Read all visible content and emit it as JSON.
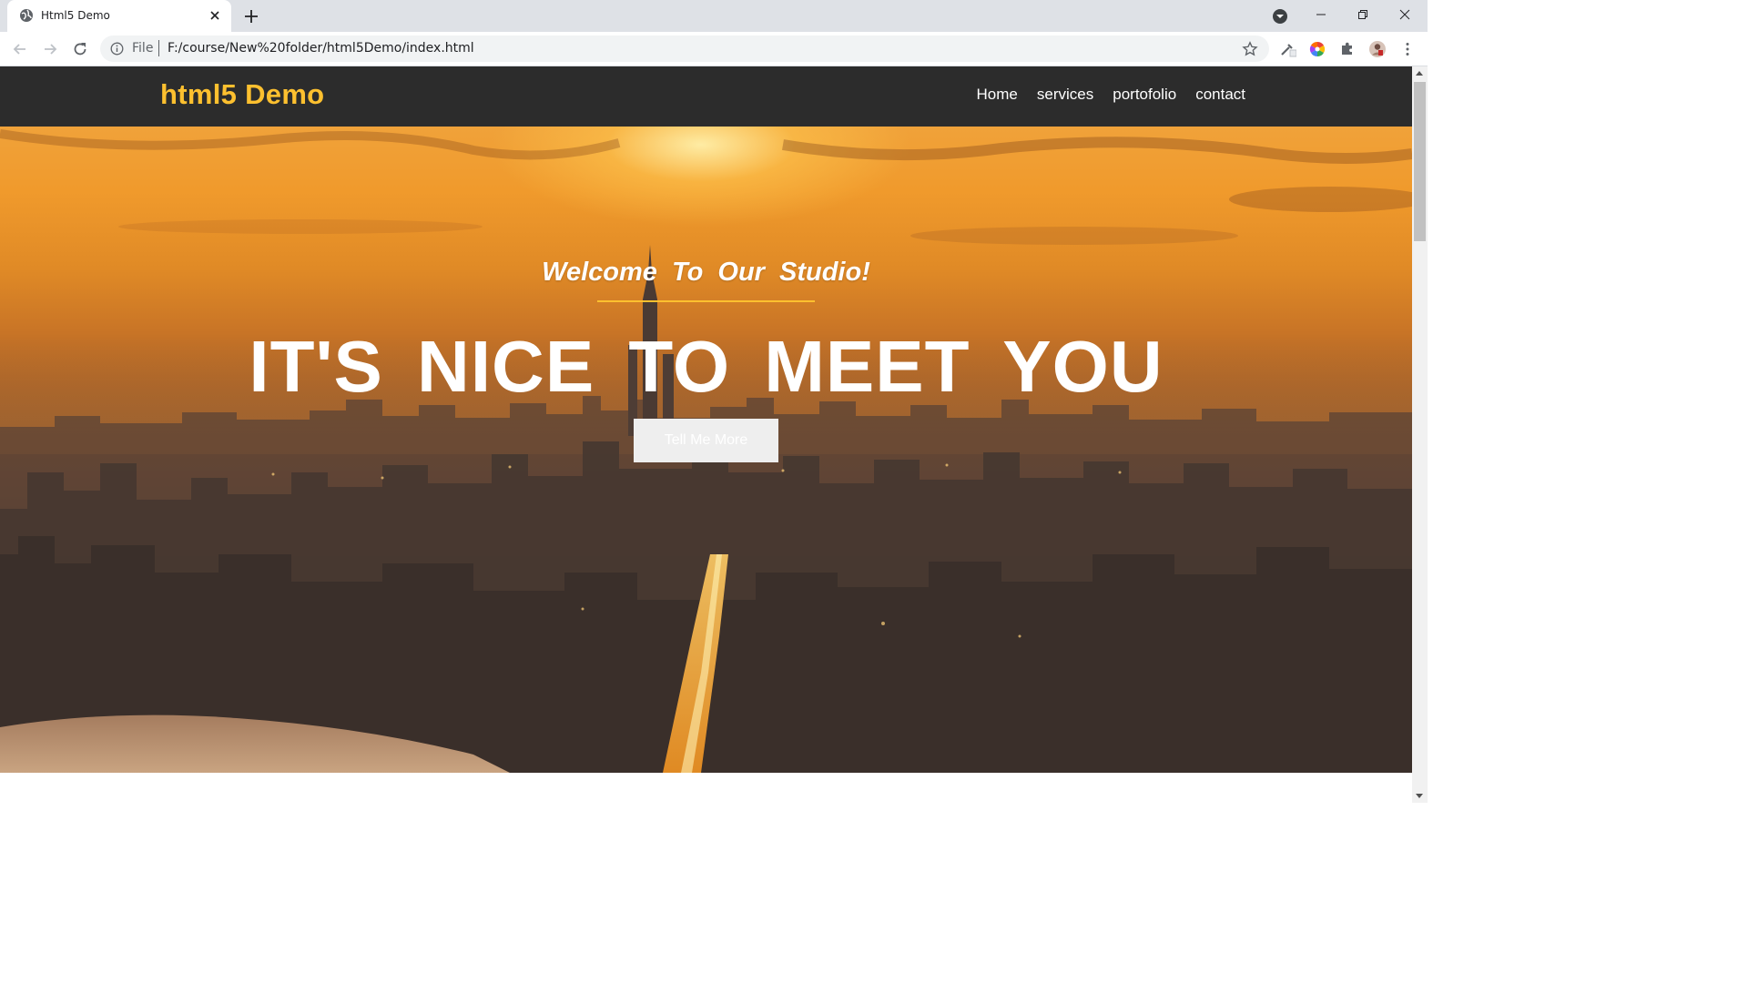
{
  "browser": {
    "tab_title": "Html5 Demo",
    "omnibox_scheme": "File",
    "url": "F:/course/New%20folder/html5Demo/index.html"
  },
  "site": {
    "logo": "html5 Demo",
    "nav": [
      {
        "label": "Home"
      },
      {
        "label": "services"
      },
      {
        "label": "portofolio"
      },
      {
        "label": "contact"
      }
    ]
  },
  "hero": {
    "subheading": "Welcome To Our Studio!",
    "heading": "IT'S NICE TO MEET YOU",
    "button_label": "Tell Me More"
  },
  "colors": {
    "brand_accent": "#fdc02f",
    "nav_background": "#2c2c2c"
  }
}
